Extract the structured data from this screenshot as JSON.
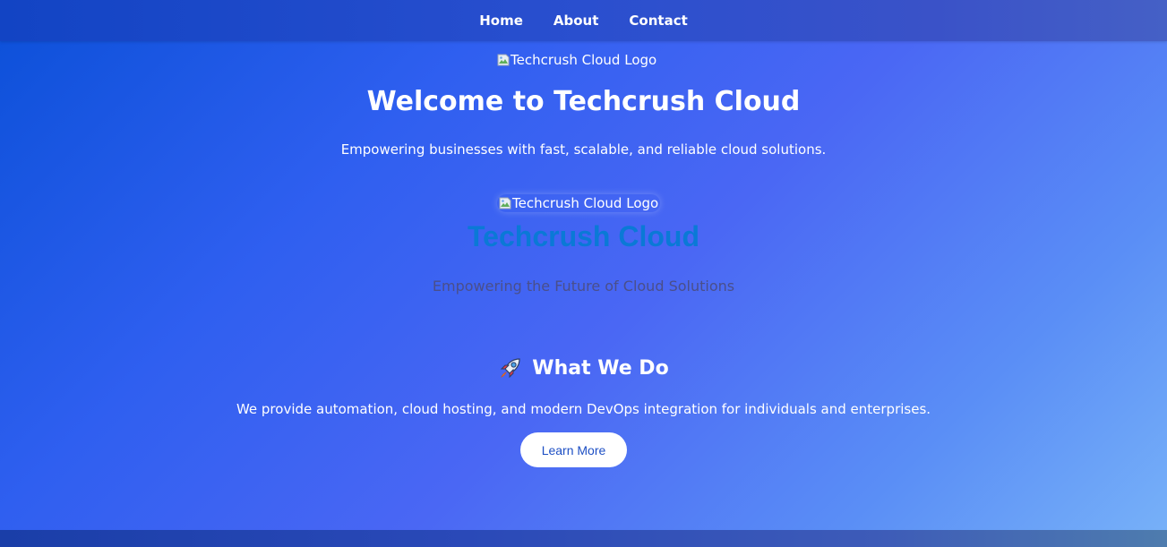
{
  "nav": {
    "links": [
      "Home",
      "About",
      "Contact"
    ]
  },
  "hero": {
    "logo_alt": "Techcrush Cloud Logo",
    "title": "Welcome to Techcrush Cloud",
    "subtitle": "Empowering businesses with fast, scalable, and reliable cloud solutions."
  },
  "brand": {
    "logo_alt": "Techcrush Cloud Logo",
    "title": "Techcrush Cloud",
    "tagline": "Empowering the Future of Cloud Solutions"
  },
  "what_we_do": {
    "icon": "rocket-icon",
    "title": "What We Do",
    "text": "We provide automation, cloud hosting, and modern DevOps integration for individuals and enterprises.",
    "button_label": "Learn More"
  },
  "colors": {
    "brand_title": "#0a79d6",
    "tagline": "#4a4f8a",
    "button_text": "#1d4fc4"
  }
}
